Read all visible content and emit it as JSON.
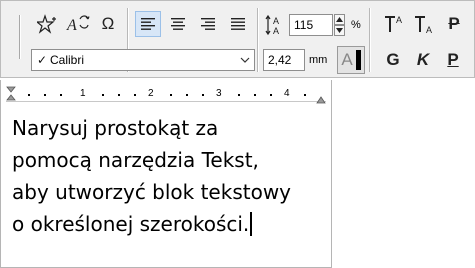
{
  "toolbar": {
    "row1": {
      "special_char_star": "star-with-sparkle-icon",
      "find_replace": "A-arrow-replace-icon",
      "omega": "Ω",
      "align_left": "align-left-icon",
      "align_center": "align-center-icon",
      "align_right": "align-right-icon",
      "justify": "justify-icon",
      "line_spacing_value": "115",
      "line_spacing_unit": "%",
      "superscript": "superscript-icon",
      "subscript": "subscript-icon",
      "strikethrough_letter": "P"
    },
    "row2": {
      "font_name": "Calibri",
      "font_check": "✓",
      "font_size_value": "2,42",
      "font_size_unit": "mm",
      "text_color_letter": "A",
      "bold_letter": "G",
      "italic_letter": "K",
      "underline_letter": "P"
    }
  },
  "ruler": {
    "numbers": [
      "1",
      "2",
      "3",
      "4"
    ]
  },
  "text_block": {
    "lines": [
      "Narysuj prostokąt za",
      "pomocą narzędzia Tekst,",
      "aby utworzyć blok tekstowy",
      "o określonej szerokości."
    ]
  },
  "colors": {
    "active_button_bg": "#d7e6f7",
    "active_button_border": "#9bc0e8",
    "toolbar_bg": "#f0f0f0"
  }
}
